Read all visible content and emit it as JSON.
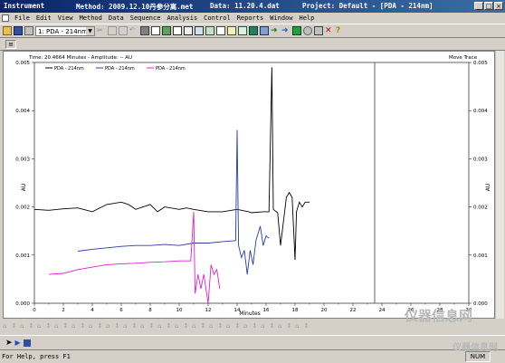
{
  "titlebar": {
    "app": "Instrument",
    "method": "Method: 2009.12.10丹参分离.met",
    "data": "Data: 11.20.4.dat",
    "project": "Project: Default - [PDA - 214nm]"
  },
  "menu": [
    "File",
    "Edit",
    "View",
    "Method",
    "Data",
    "Sequence",
    "Analysis",
    "Control",
    "Reports",
    "Window",
    "Help"
  ],
  "toolbar": {
    "channel_select": "1: PDA - 214nm"
  },
  "plot": {
    "header_left": "Time:  20.4664 Minutes - Amplitude: -- AU",
    "header_right": "Move Trace"
  },
  "status": {
    "help_text": "For Help, press F1",
    "num": "NUM"
  },
  "watermark": {
    "large": "仪器信息网",
    "small": "仪器信息网"
  },
  "chart_data": {
    "type": "line",
    "title": "",
    "xlabel": "Minutes",
    "ylabel": "AU",
    "ylabel_right": "AU",
    "xlim": [
      0,
      30
    ],
    "ylim": [
      0,
      0.005
    ],
    "x_ticks": [
      0,
      2,
      4,
      6,
      8,
      10,
      12,
      14,
      16,
      18,
      20,
      22,
      24,
      26,
      28,
      30
    ],
    "y_ticks": [
      "0.000",
      "0.001",
      "0.002",
      "0.003",
      "0.004",
      "0.005"
    ],
    "legend": [
      "PDA - 214nm",
      "PDA - 214nm",
      "PDA - 214nm"
    ],
    "marker_x": 23.5,
    "series": [
      {
        "name": "PDA - 214nm",
        "color": "#000000",
        "points": [
          [
            0,
            0.00195
          ],
          [
            1,
            0.00193
          ],
          [
            2,
            0.00196
          ],
          [
            3,
            0.00198
          ],
          [
            4,
            0.0019
          ],
          [
            5,
            0.00205
          ],
          [
            6,
            0.0021
          ],
          [
            6.5,
            0.00205
          ],
          [
            7,
            0.00195
          ],
          [
            8,
            0.00205
          ],
          [
            8.5,
            0.0019
          ],
          [
            9,
            0.002
          ],
          [
            10,
            0.00195
          ],
          [
            10.5,
            0.00198
          ],
          [
            11,
            0.00195
          ],
          [
            12,
            0.0019
          ],
          [
            13,
            0.0019
          ],
          [
            14,
            0.00195
          ],
          [
            14.8,
            0.0019
          ],
          [
            15,
            0.00188
          ],
          [
            15.8,
            0.0019
          ],
          [
            16.2,
            0.0019
          ],
          [
            16.4,
            0.0049
          ],
          [
            16.5,
            0.00195
          ],
          [
            16.8,
            0.00188
          ],
          [
            17,
            0.0012
          ],
          [
            17.2,
            0.0017
          ],
          [
            17.4,
            0.0022
          ],
          [
            17.6,
            0.0023
          ],
          [
            17.8,
            0.0022
          ],
          [
            18,
            0.0009
          ],
          [
            18.1,
            0.0019
          ],
          [
            18.3,
            0.0021
          ],
          [
            18.5,
            0.002
          ],
          [
            18.7,
            0.0021
          ],
          [
            19,
            0.0021
          ]
        ]
      },
      {
        "name": "PDA - 214nm",
        "color": "#2a3ca8",
        "points": [
          [
            3,
            0.00108
          ],
          [
            4,
            0.00112
          ],
          [
            5,
            0.00115
          ],
          [
            6,
            0.00118
          ],
          [
            7,
            0.0012
          ],
          [
            8,
            0.0012
          ],
          [
            9,
            0.00122
          ],
          [
            10,
            0.0012
          ],
          [
            11,
            0.00125
          ],
          [
            12,
            0.00125
          ],
          [
            13,
            0.00128
          ],
          [
            13.9,
            0.0013
          ],
          [
            14,
            0.0036
          ],
          [
            14.1,
            0.0012
          ],
          [
            14.3,
            0.00095
          ],
          [
            14.5,
            0.0011
          ],
          [
            14.7,
            0.0006
          ],
          [
            14.9,
            0.0011
          ],
          [
            15.1,
            0.0008
          ],
          [
            15.3,
            0.0013
          ],
          [
            15.6,
            0.0016
          ],
          [
            15.8,
            0.0012
          ],
          [
            16,
            0.0014
          ],
          [
            16.2,
            0.00135
          ]
        ]
      },
      {
        "name": "PDA - 214nm",
        "color": "#e020d0",
        "points": [
          [
            1,
            0.0006
          ],
          [
            2,
            0.00062
          ],
          [
            3,
            0.0007
          ],
          [
            4,
            0.00075
          ],
          [
            5,
            0.0008
          ],
          [
            6,
            0.00082
          ],
          [
            7,
            0.00083
          ],
          [
            8,
            0.00085
          ],
          [
            9,
            0.00086
          ],
          [
            10,
            0.00088
          ],
          [
            10.8,
            0.00088
          ],
          [
            11,
            0.0019
          ],
          [
            11.1,
            0.0002
          ],
          [
            11.3,
            0.0006
          ],
          [
            11.5,
            0.0003
          ],
          [
            11.7,
            0.0006
          ],
          [
            11.9,
            0.0002
          ],
          [
            12,
            0.0
          ],
          [
            12.2,
            0.0008
          ],
          [
            12.4,
            0.0006
          ],
          [
            12.6,
            0.0007
          ],
          [
            12.8,
            0.0003
          ]
        ]
      }
    ]
  }
}
